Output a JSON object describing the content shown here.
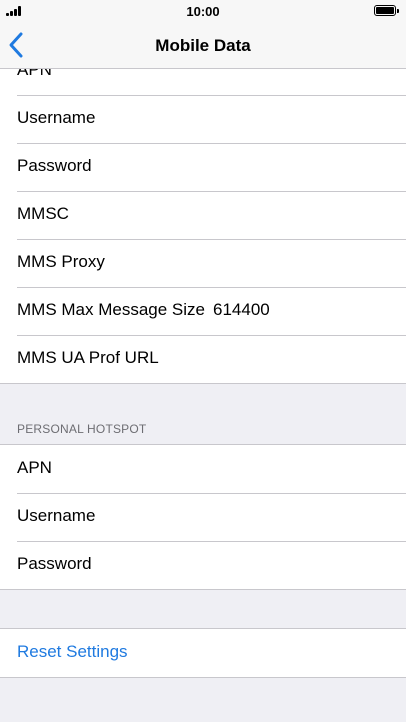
{
  "status_bar": {
    "time": "10:00"
  },
  "nav": {
    "title": "Mobile Data",
    "back_icon": "chevron-left-icon"
  },
  "mms_section": {
    "rows": [
      {
        "label": "APN",
        "value": ""
      },
      {
        "label": "Username",
        "value": ""
      },
      {
        "label": "Password",
        "value": ""
      },
      {
        "label": "MMSC",
        "value": ""
      },
      {
        "label": "MMS Proxy",
        "value": ""
      },
      {
        "label": "MMS Max Message Size",
        "value": "614400"
      },
      {
        "label": "MMS UA Prof URL",
        "value": ""
      }
    ]
  },
  "hotspot_section": {
    "header": "PERSONAL HOTSPOT",
    "rows": [
      {
        "label": "APN"
      },
      {
        "label": "Username"
      },
      {
        "label": "Password"
      }
    ]
  },
  "reset": {
    "label": "Reset Settings"
  },
  "colors": {
    "accent": "#1f7ae0",
    "background": "#efeff4",
    "separator": "#c8c7cc"
  }
}
